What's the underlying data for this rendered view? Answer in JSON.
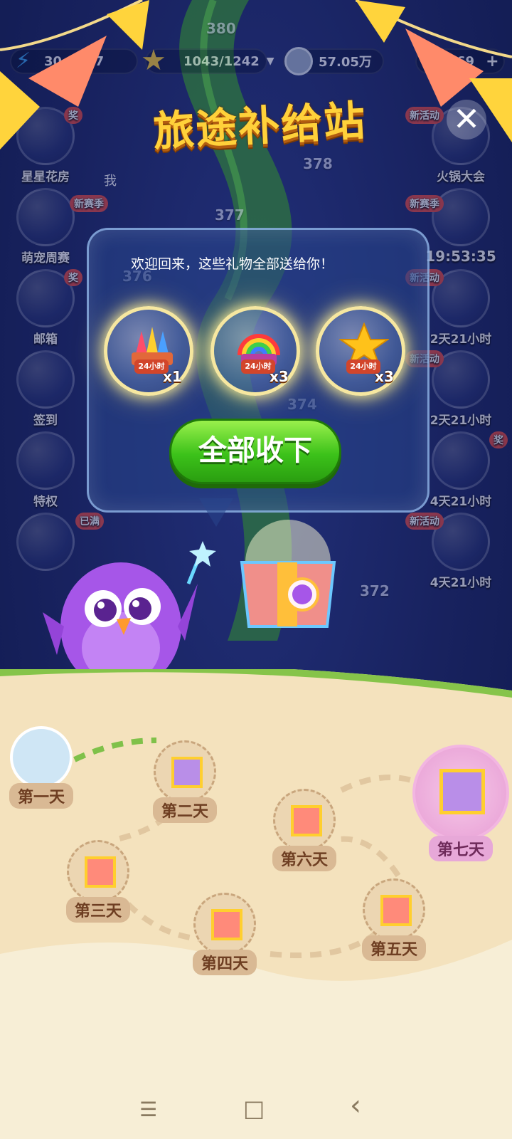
{
  "levels": [
    "380",
    "378",
    "377",
    "376",
    "374",
    "372"
  ],
  "hud": {
    "lives": "30",
    "lives_time": "37",
    "stars": "1043/1242",
    "coins": "57.05万",
    "gems": "69"
  },
  "left_menu": [
    {
      "label": "星星花房",
      "badge": "奖"
    },
    {
      "label": "萌宠周赛",
      "badge": "新赛季"
    },
    {
      "label": "邮箱",
      "badge": "奖"
    },
    {
      "label": "签到",
      "badge": ""
    },
    {
      "label": "特权",
      "badge": ""
    },
    {
      "label": "",
      "badge": "已满"
    }
  ],
  "right_menu": [
    {
      "label": "火锅大会",
      "badge": "新活动"
    },
    {
      "label": "19:53:35",
      "badge": "新赛季"
    },
    {
      "label": "2天21小时",
      "badge": "新活动"
    },
    {
      "label": "2天21小时",
      "badge": "新活动"
    },
    {
      "label": "4天21小时",
      "badge": "奖"
    },
    {
      "label": "4天21小时",
      "badge": "新活动"
    }
  ],
  "avatar_name": "我",
  "popup": {
    "title": "旅途补给站",
    "welcome": "欢迎回来，这些礼物全部送给你！",
    "rewards": [
      {
        "icon": "fireworks-booster-icon",
        "tag": "24小时",
        "count": "x1"
      },
      {
        "icon": "rainbow-booster-icon",
        "tag": "24小时",
        "count": "x3"
      },
      {
        "icon": "star-booster-icon",
        "tag": "24小时",
        "count": "x3"
      }
    ],
    "collect_button": "全部收下"
  },
  "days": [
    {
      "label": "第一天",
      "state": "current"
    },
    {
      "label": "第二天",
      "state": "gift"
    },
    {
      "label": "第三天",
      "state": "gift"
    },
    {
      "label": "第四天",
      "state": "gift"
    },
    {
      "label": "第五天",
      "state": "gift"
    },
    {
      "label": "第六天",
      "state": "gift"
    },
    {
      "label": "第七天",
      "state": "grand"
    }
  ],
  "colors": {
    "title": "#ffd13a",
    "button": "#3cc21a",
    "panel_border": "#aad2ff",
    "map": "#f4e2bd"
  },
  "nav": {
    "menu": "☰",
    "home": "□",
    "back": "‹"
  }
}
